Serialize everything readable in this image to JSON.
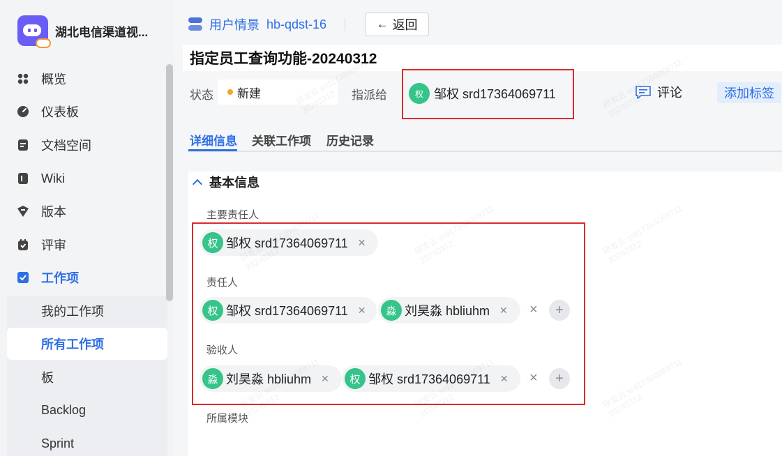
{
  "app": {
    "name": "湖北电信渠道视..."
  },
  "sidebar": {
    "items": [
      {
        "label": "概览",
        "icon": "overview-icon"
      },
      {
        "label": "仪表板",
        "icon": "dashboard-icon"
      },
      {
        "label": "文档空间",
        "icon": "document-icon"
      },
      {
        "label": "Wiki",
        "icon": "wiki-icon"
      },
      {
        "label": "版本",
        "icon": "version-icon"
      },
      {
        "label": "评审",
        "icon": "review-icon"
      },
      {
        "label": "工作项",
        "icon": "workitem-icon",
        "active": true
      }
    ],
    "sub_items": [
      {
        "label": "我的工作项"
      },
      {
        "label": "所有工作项",
        "selected": true
      },
      {
        "label": "板"
      },
      {
        "label": "Backlog"
      },
      {
        "label": "Sprint"
      }
    ]
  },
  "header": {
    "type_label": "用户情景",
    "item_id": "hb-qdst-16",
    "back_label": "返回"
  },
  "work_item": {
    "title": "指定员工查询功能-20240312",
    "status_label": "状态",
    "status_value": "新建",
    "status_color": "#f5a623",
    "assign_label": "指派给",
    "assignee_avatar": "权",
    "assignee_name": "邹权 srd17364069711",
    "comment_label": "评论",
    "add_tag_label": "添加标签"
  },
  "tabs": [
    {
      "label": "详细信息",
      "active": true
    },
    {
      "label": "关联工作项"
    },
    {
      "label": "历史记录"
    }
  ],
  "basic_info": {
    "section_title": "基本信息",
    "main_owner_label": "主要责任人",
    "main_owner": [
      {
        "avatar": "权",
        "name": "邹权 srd17364069711"
      }
    ],
    "owners_label": "责任人",
    "owners": [
      {
        "avatar": "权",
        "name": "邹权 srd17364069711"
      },
      {
        "avatar": "淼",
        "name": "刘昊淼 hbliuhm"
      }
    ],
    "acceptors_label": "验收人",
    "acceptors": [
      {
        "avatar": "淼",
        "name": "刘昊淼 hbliuhm"
      },
      {
        "avatar": "权",
        "name": "邹权 srd17364069711"
      }
    ],
    "module_label": "所属模块"
  },
  "watermark": {
    "line1": "研发云 srd17364069711",
    "line2": "20240312"
  },
  "colors": {
    "accent": "#2f6fe5",
    "avatar": "#35c48a",
    "highlight": "#d92b2b"
  }
}
